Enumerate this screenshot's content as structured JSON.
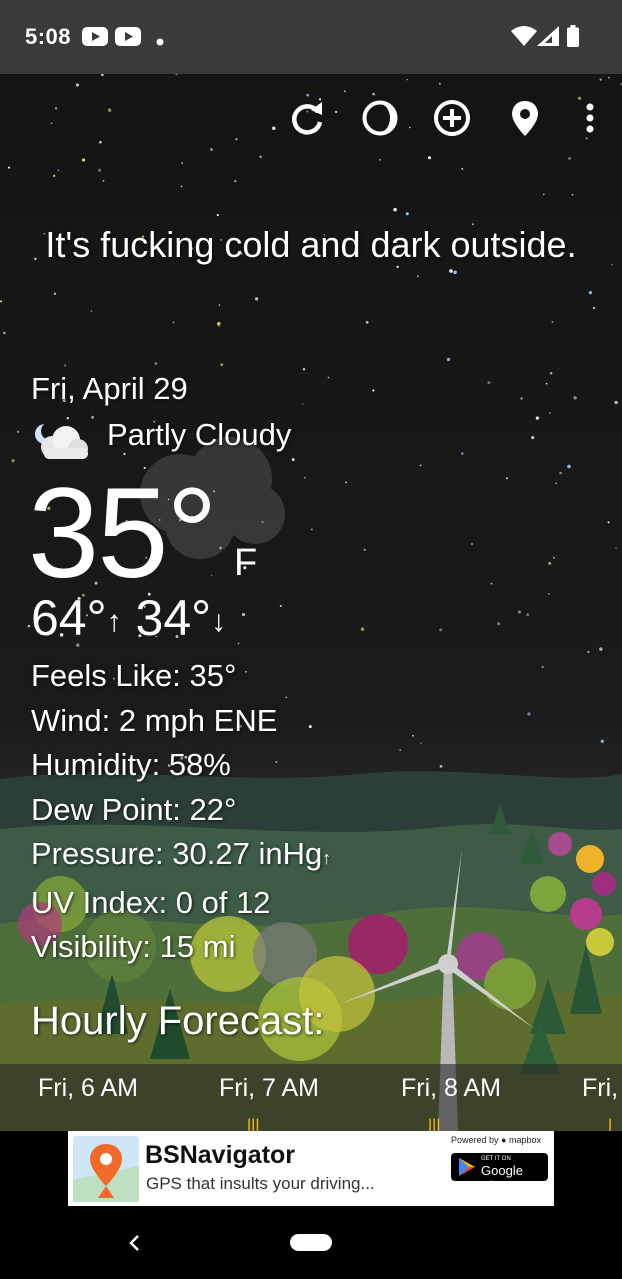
{
  "status_bar": {
    "time": "5:08",
    "icons": [
      "youtube-icon",
      "youtube-icon",
      "notification-dot-icon",
      "wifi-icon",
      "cellular-icon",
      "battery-icon"
    ]
  },
  "toolbar": {
    "icons": [
      "refresh-icon",
      "theme-icon",
      "add-location-icon",
      "location-pin-icon",
      "more-vert-icon"
    ]
  },
  "weather": {
    "headline": "It's fucking cold and dark outside.",
    "date": "Fri, April 29",
    "condition_icon": "partly-cloudy-night-icon",
    "condition": "Partly Cloudy",
    "temperature": "35°",
    "unit": "F",
    "high": "64°",
    "high_arrow": "↑",
    "low": "34°",
    "low_arrow": "↓",
    "details": [
      {
        "label": "Feels Like:",
        "value": "35°"
      },
      {
        "label": "Wind:",
        "value": "2 mph ENE"
      },
      {
        "label": "Humidity:",
        "value": "58%"
      },
      {
        "label": "Dew Point:",
        "value": "22°"
      },
      {
        "label": "Pressure:",
        "value": "30.27 inHg",
        "trend": "↑"
      },
      {
        "label": "UV Index:",
        "value": "0 of 12"
      },
      {
        "label": "Visibility:",
        "value": "15 mi"
      }
    ]
  },
  "hourly": {
    "title": "Hourly Forecast:",
    "items": [
      "Fri, 6 AM",
      "Fri, 7 AM",
      "Fri, 8 AM",
      "Fri,"
    ]
  },
  "ad": {
    "title": "BSNavigator",
    "subtitle": "GPS that insults your driving...",
    "powered_by": "Powered by",
    "powered_brand": "mapbox",
    "store_get": "GET IT ON",
    "store_name": "Google Play"
  },
  "nav_bar": {
    "icons": [
      "back-icon",
      "home-pill"
    ]
  }
}
